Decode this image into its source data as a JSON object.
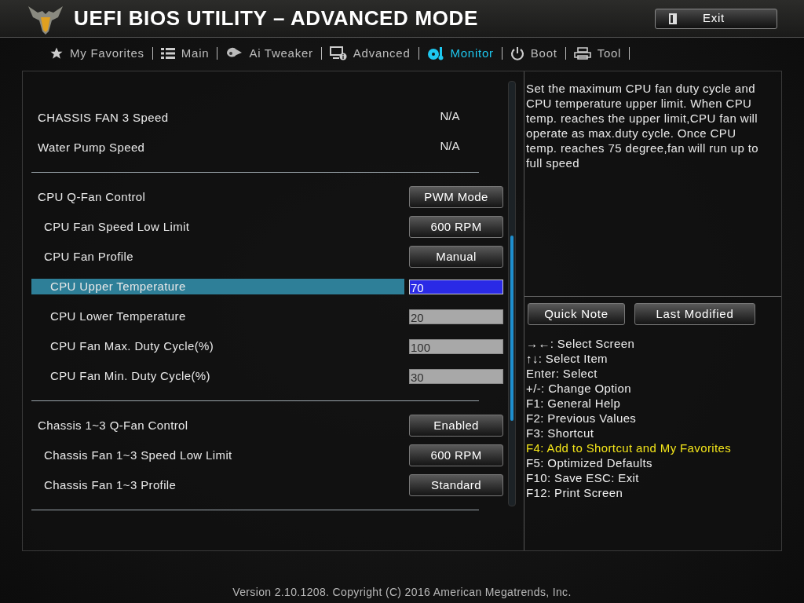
{
  "header": {
    "title": "UEFI BIOS UTILITY – ADVANCED MODE",
    "exit_button": "Exit"
  },
  "tabs": [
    {
      "label": "My Favorites",
      "selected": false
    },
    {
      "label": "Main",
      "selected": false
    },
    {
      "label": "Ai Tweaker",
      "selected": false
    },
    {
      "label": "Advanced",
      "selected": false
    },
    {
      "label": "Monitor",
      "selected": true
    },
    {
      "label": "Boot",
      "selected": false
    },
    {
      "label": "Tool",
      "selected": false
    }
  ],
  "sections": [
    {
      "items": [
        {
          "label": "CHASSIS FAN 3 Speed",
          "kind": "reading",
          "value": "N/A"
        },
        {
          "label": "Water Pump Speed",
          "kind": "reading",
          "value": "N/A"
        }
      ]
    },
    {
      "items": [
        {
          "label": "CPU Q-Fan Control",
          "kind": "option",
          "value": "PWM Mode",
          "children": [
            {
              "label": "CPU Fan Speed Low Limit",
              "kind": "option",
              "value": "600 RPM"
            },
            {
              "label": "CPU Fan Profile",
              "kind": "option",
              "value": "Manual",
              "children": [
                {
                  "label": "CPU Upper Temperature",
                  "kind": "number",
                  "value": "70",
                  "selected": true
                },
                {
                  "label": "CPU Lower Temperature",
                  "kind": "number",
                  "value": "20",
                  "selected": false
                },
                {
                  "label": "CPU Fan Max. Duty Cycle(%)",
                  "kind": "number",
                  "value": "100",
                  "selected": false
                },
                {
                  "label": "CPU Fan Min. Duty Cycle(%)",
                  "kind": "number",
                  "value": "30",
                  "selected": false
                }
              ]
            }
          ]
        }
      ]
    },
    {
      "items": [
        {
          "label": "Chassis 1~3 Q-Fan Control",
          "kind": "option",
          "value": "Enabled",
          "children": [
            {
              "label": "Chassis Fan 1~3 Speed Low Limit",
              "kind": "option",
              "value": "600 RPM"
            },
            {
              "label": "Chassis Fan 1~3 Profile",
              "kind": "option",
              "value": "Standard"
            }
          ]
        }
      ]
    }
  ],
  "help_text": "Set the maximum CPU fan duty cycle and CPU temperature upper limit. When CPU temp. reaches the upper limit,CPU fan will operate as max.duty cycle. Once CPU temp. reaches 75 degree,fan will run up to full speed",
  "side_buttons": [
    "Quick Note",
    "Last Modified"
  ],
  "keys": [
    {
      "text": "→←: Select Screen",
      "highlighted": false
    },
    {
      "text": "↑↓: Select Item",
      "highlighted": false
    },
    {
      "text": "Enter: Select",
      "highlighted": false
    },
    {
      "text": "+/-: Change Option",
      "highlighted": false
    },
    {
      "text": "F1: General Help",
      "highlighted": false
    },
    {
      "text": "F2: Previous Values",
      "highlighted": false
    },
    {
      "text": "F3: Shortcut",
      "highlighted": false
    },
    {
      "text": "F4: Add to Shortcut and My Favorites",
      "highlighted": true
    },
    {
      "text": "F5: Optimized Defaults",
      "highlighted": false
    },
    {
      "text": "F10: Save  ESC: Exit",
      "highlighted": false
    },
    {
      "text": "F12: Print Screen",
      "highlighted": false
    }
  ],
  "footer": "Version 2.10.1208. Copyright (C) 2016 American Megatrends, Inc."
}
